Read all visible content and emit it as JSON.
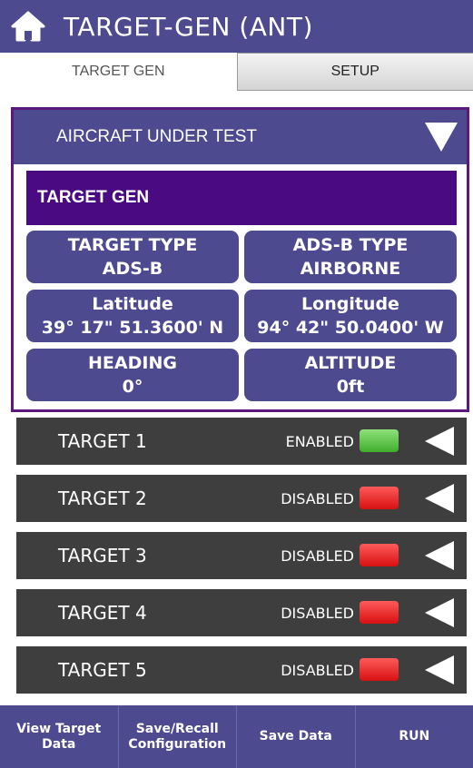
{
  "titlebar": {
    "title": "TARGET-GEN (ANT)",
    "icon": "home-icon"
  },
  "tabs": [
    {
      "label": "TARGET GEN",
      "active": true
    },
    {
      "label": "SETUP",
      "active": false
    }
  ],
  "aircraft_under_test": {
    "header": "AIRCRAFT UNDER TEST",
    "section_title": "TARGET GEN",
    "fields": [
      {
        "label": "TARGET TYPE",
        "value": "ADS-B"
      },
      {
        "label": "ADS-B TYPE",
        "value": "AIRBORNE"
      },
      {
        "label": "Latitude",
        "value": "39° 17\" 51.3600' N"
      },
      {
        "label": "Longitude",
        "value": "94° 42\" 50.0400' W"
      },
      {
        "label": "HEADING",
        "value": "0°"
      },
      {
        "label": "ALTITUDE",
        "value": "0ft"
      }
    ]
  },
  "targets": [
    {
      "name": "TARGET 1",
      "status": "ENABLED",
      "color": "#4fbf3a"
    },
    {
      "name": "TARGET 2",
      "status": "DISABLED",
      "color": "#e82020"
    },
    {
      "name": "TARGET 3",
      "status": "DISABLED",
      "color": "#e82020"
    },
    {
      "name": "TARGET 4",
      "status": "DISABLED",
      "color": "#e82020"
    },
    {
      "name": "TARGET 5",
      "status": "DISABLED",
      "color": "#e82020"
    }
  ],
  "bottom_buttons": [
    {
      "label": "View Target\nData"
    },
    {
      "label": "Save/Recall\nConfiguration"
    },
    {
      "label": "Save Data"
    },
    {
      "label": "RUN"
    }
  ],
  "colors": {
    "primary": "#4d4a8f",
    "section": "#4a0b82",
    "row": "#3e3e3e"
  }
}
